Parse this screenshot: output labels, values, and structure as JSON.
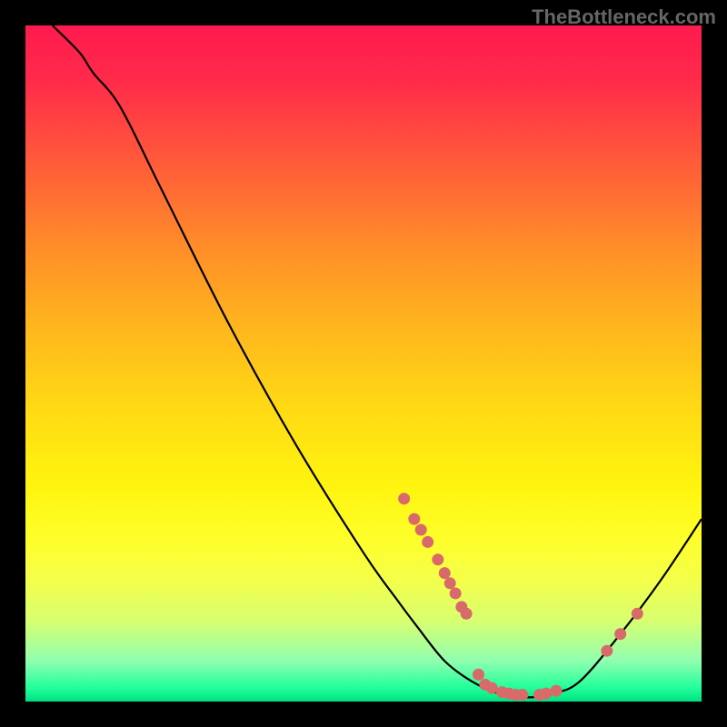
{
  "watermark": "TheBottleneck.com",
  "chart_data": {
    "type": "line",
    "title": "",
    "xlabel": "",
    "ylabel": "",
    "xlim": [
      0,
      100
    ],
    "ylim": [
      0,
      100
    ],
    "curve": [
      {
        "x": 4,
        "y": 100
      },
      {
        "x": 8,
        "y": 96
      },
      {
        "x": 10,
        "y": 93
      },
      {
        "x": 14,
        "y": 88
      },
      {
        "x": 20,
        "y": 76
      },
      {
        "x": 30,
        "y": 56
      },
      {
        "x": 40,
        "y": 38
      },
      {
        "x": 50,
        "y": 22
      },
      {
        "x": 55,
        "y": 15
      },
      {
        "x": 58,
        "y": 11
      },
      {
        "x": 62,
        "y": 6
      },
      {
        "x": 66,
        "y": 3
      },
      {
        "x": 70,
        "y": 1.2
      },
      {
        "x": 74,
        "y": 0.6
      },
      {
        "x": 78,
        "y": 1.2
      },
      {
        "x": 82,
        "y": 3
      },
      {
        "x": 88,
        "y": 10
      },
      {
        "x": 94,
        "y": 18
      },
      {
        "x": 100,
        "y": 27
      }
    ],
    "markers": [
      {
        "x": 56,
        "y": 30
      },
      {
        "x": 57.5,
        "y": 27
      },
      {
        "x": 58.5,
        "y": 25.4
      },
      {
        "x": 59.5,
        "y": 23.6
      },
      {
        "x": 61,
        "y": 21
      },
      {
        "x": 62,
        "y": 19
      },
      {
        "x": 62.8,
        "y": 17.5
      },
      {
        "x": 63.6,
        "y": 16
      },
      {
        "x": 64.5,
        "y": 14
      },
      {
        "x": 65.2,
        "y": 13
      },
      {
        "x": 67,
        "y": 4
      },
      {
        "x": 68,
        "y": 2.5
      },
      {
        "x": 69,
        "y": 2
      },
      {
        "x": 70.5,
        "y": 1.4
      },
      {
        "x": 71.5,
        "y": 1.2
      },
      {
        "x": 72.5,
        "y": 1
      },
      {
        "x": 73.5,
        "y": 1
      },
      {
        "x": 76,
        "y": 1
      },
      {
        "x": 77,
        "y": 1.2
      },
      {
        "x": 78.5,
        "y": 1.6
      },
      {
        "x": 86,
        "y": 7.5
      },
      {
        "x": 88,
        "y": 10
      },
      {
        "x": 90.5,
        "y": 13
      }
    ],
    "marker_color": "#d96a6a",
    "line_color": "#000000"
  }
}
